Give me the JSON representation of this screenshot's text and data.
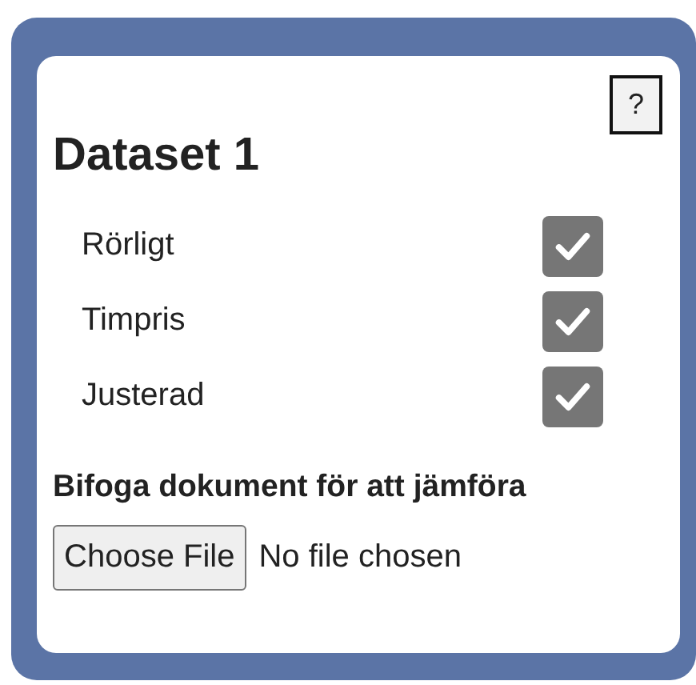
{
  "help_button": {
    "label": "?"
  },
  "title": "Dataset 1",
  "options": [
    {
      "label": "Rörligt",
      "checked": true
    },
    {
      "label": "Timpris",
      "checked": true
    },
    {
      "label": "Justerad",
      "checked": true
    }
  ],
  "attachment": {
    "label": "Bifoga dokument för att jämföra",
    "button": "Choose File",
    "status": "No file chosen"
  }
}
